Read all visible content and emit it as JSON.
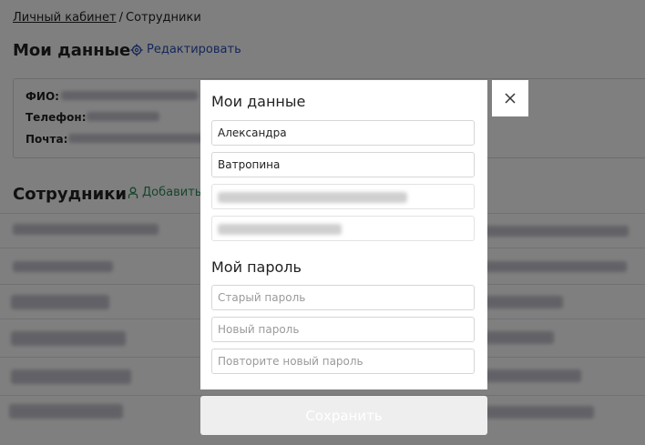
{
  "breadcrumb": {
    "home": "Личный кабинет",
    "separator": "/",
    "current": "Сотрудники"
  },
  "profile": {
    "title": "Мои данные",
    "edit_label": "Редактировать",
    "fio_label": "ФИО:",
    "phone_label": "Телефон:",
    "email_label": "Почта:"
  },
  "employees": {
    "title": "Сотрудники",
    "add_label": "Добавить"
  },
  "modal": {
    "data_heading": "Мои данные",
    "first_name_value": "Александра",
    "last_name_value": "Ватропина",
    "password_heading": "Мой пароль",
    "old_password_placeholder": "Старый пароль",
    "new_password_placeholder": "Новый пароль",
    "repeat_password_placeholder": "Повторите новый пароль",
    "save_label": "Сохранить"
  },
  "icons": {
    "edit": "gear-icon",
    "add": "person-icon",
    "close": "close-icon"
  },
  "colors": {
    "link_blue": "#2c4fb4",
    "add_green": "#2e8b57",
    "overlay": "rgba(0,0,0,0.5)",
    "save_disabled": "#eeeeee"
  }
}
